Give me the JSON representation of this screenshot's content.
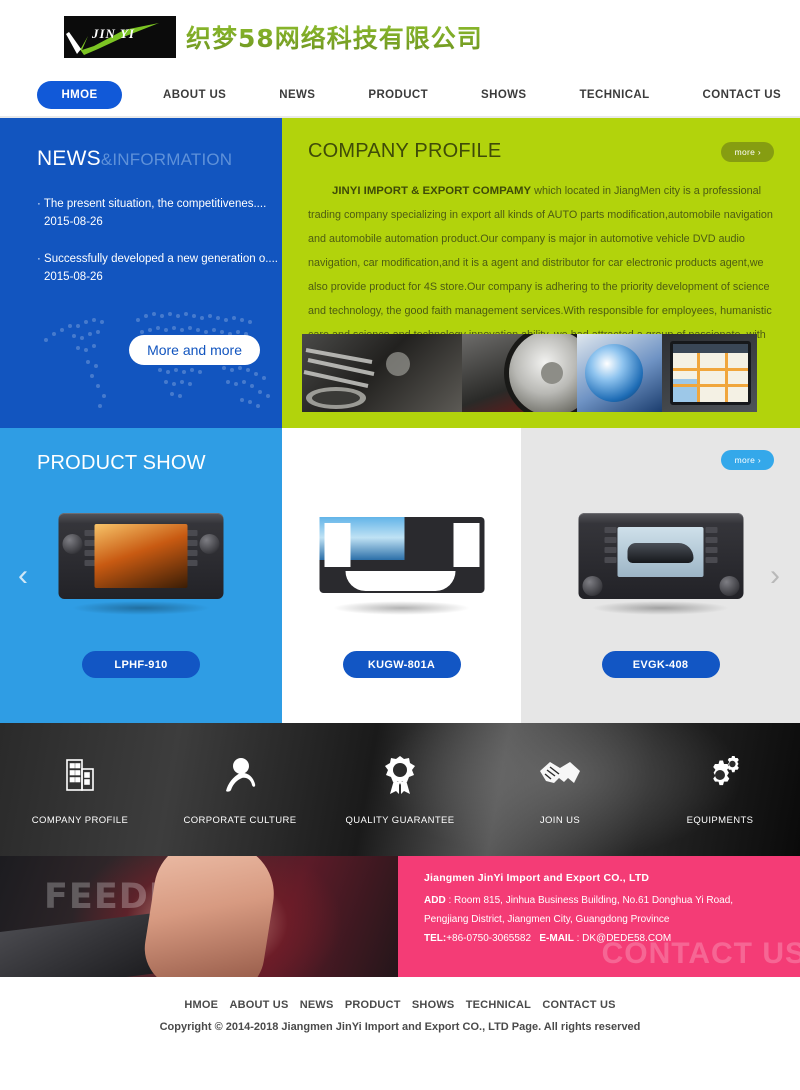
{
  "header": {
    "logo_mark": "JIN YI",
    "company_name_cn": "织梦58网络科技有限公司"
  },
  "nav": {
    "items": [
      {
        "label": "HMOE",
        "active": true
      },
      {
        "label": "ABOUT US",
        "active": false
      },
      {
        "label": "NEWS",
        "active": false
      },
      {
        "label": "PRODUCT",
        "active": false
      },
      {
        "label": "SHOWS",
        "active": false
      },
      {
        "label": "TECHNICAL",
        "active": false
      },
      {
        "label": "CONTACT US",
        "active": false
      }
    ]
  },
  "news": {
    "title_main": "NEWS",
    "title_sub": "&INFORMATION",
    "items": [
      {
        "title": "· The present situation, the competitivenes....",
        "date": "2015-08-26"
      },
      {
        "title": "· Successfully developed a new generation o....",
        "date": "2015-08-26"
      }
    ],
    "more_label": "More and more",
    "bg_color": "#1255bf"
  },
  "profile": {
    "title": "COMPANY PROFILE",
    "more_label": "more ›",
    "lead": "JINYI IMPORT & EXPORT COMPAMY",
    "body": " which located in JiangMen city is a professional trading company specializing in export all kinds of AUTO parts modification,automobile navigation and automobile automation product.Our company is major in automotive vehicle DVD audio navigation, car modification,and it is a agent and distributor for car electronic products agent,we also provide product for 4S store.Our company is adhering to the priority development of science and technology, the good faith management services.With responsible for employees, humanistic care and science and technology innovation ability, we had attracted a group of passionate, with the ultimate goal of backbone of the industry,our comapny have standard production ...",
    "bg_color": "#b2d30c"
  },
  "products": {
    "title": "PRODUCT SHOW",
    "more_label": "more ›",
    "prev_arrow": "‹",
    "next_arrow": "›",
    "items": [
      {
        "name": "LPHF-910"
      },
      {
        "name": "KUGW-801A"
      },
      {
        "name": "EVGK-408"
      }
    ],
    "bg_color": "#2f9de4"
  },
  "services": {
    "items": [
      {
        "label": "COMPANY PROFILE",
        "icon": "building-icon"
      },
      {
        "label": "CORPORATE CULTURE",
        "icon": "person-icon"
      },
      {
        "label": "QUALITY GUARANTEE",
        "icon": "award-ribbon-icon"
      },
      {
        "label": "JOIN US",
        "icon": "handshake-icon"
      },
      {
        "label": "EQUIPMENTS",
        "icon": "gears-icon"
      }
    ]
  },
  "feedback": {
    "watermark": "FEEDBACK"
  },
  "contact": {
    "ghost_text": "CONTACT US",
    "company": "Jiangmen JinYi Import and Export CO., LTD",
    "add_label": "ADD",
    "address": " : Room 815, Jinhua Business Building, No.61 Donghua Yi Road, Pengjiang District, Jiangmen City, Guangdong Province",
    "tel_label": "TEL:",
    "tel": "+86-0750-3065582",
    "email_label": "E-MAIL",
    "email": " : DK@DEDE58.COM",
    "bg_color": "#f43c76"
  },
  "footer": {
    "nav": [
      "HMOE",
      "ABOUT US",
      "NEWS",
      "PRODUCT",
      "SHOWS",
      "TECHNICAL",
      "CONTACT US"
    ],
    "copyright": "Copyright © 2014-2018 Jiangmen JinYi Import and Export CO., LTD   Page. All rights reserved"
  }
}
